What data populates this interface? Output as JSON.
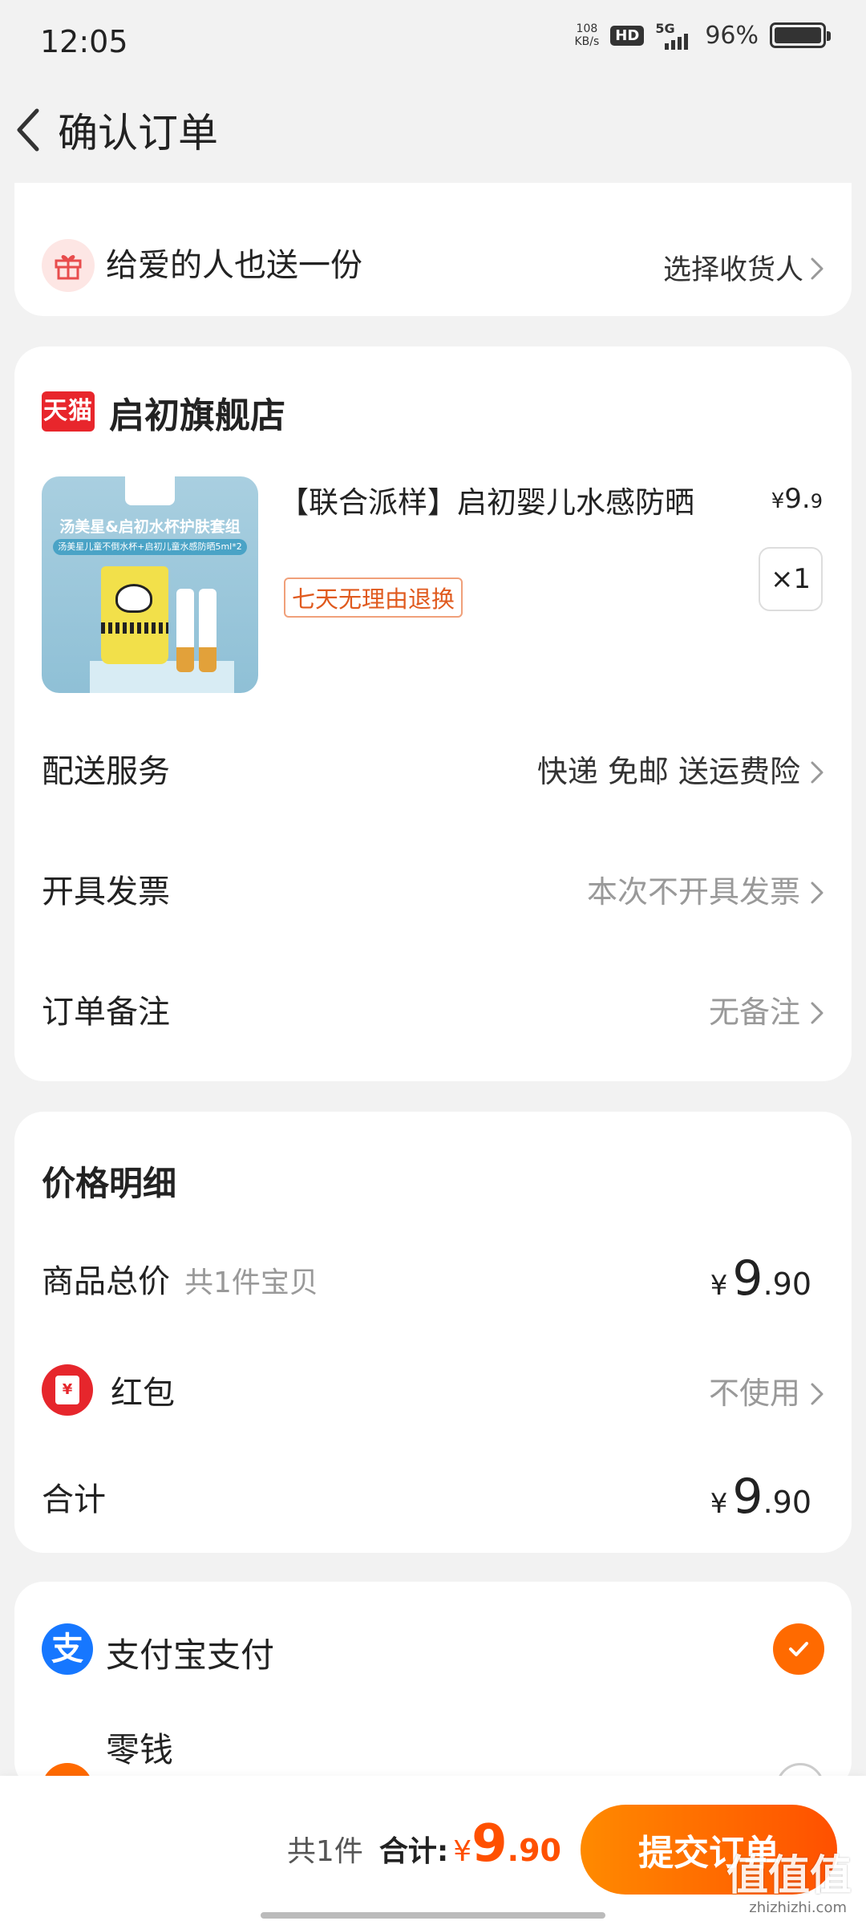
{
  "status_bar": {
    "time": "12:05",
    "net_speed_value": "108",
    "net_speed_unit": "KB/s",
    "hd_badge": "HD",
    "network": "5G",
    "battery_percent": "96%",
    "battery_level": 0.96
  },
  "header": {
    "title": "确认订单",
    "back_icon": "chevron-left-icon"
  },
  "gift": {
    "icon": "gift-icon",
    "text": "给爱的人也送一份",
    "action": "选择收货人"
  },
  "shop": {
    "logo_text": "天猫",
    "name": "启初旗舰店",
    "product": {
      "image_title": "汤美星&启初水杯护肤套组",
      "image_subtitle": "汤美星儿童不倒水杯+启初儿童水感防晒5ml*2",
      "name": "【联合派样】启初婴儿水感防晒",
      "price_currency": "¥",
      "price_int": "9.",
      "price_dec": "9",
      "return_policy": "七天无理由退换",
      "quantity": "×1"
    },
    "rows": [
      {
        "label": "配送服务",
        "value": "快递 免邮 送运费险"
      },
      {
        "label": "开具发票",
        "value": "本次不开具发票"
      },
      {
        "label": "订单备注",
        "value": "无备注"
      }
    ]
  },
  "price_detail": {
    "title": "价格明细",
    "goods_total": {
      "label": "商品总价",
      "sub": "共1件宝贝",
      "currency": "¥",
      "int": "9",
      "dec": ".90"
    },
    "red_packet": {
      "icon_text": "¥",
      "label": "红包",
      "value": "不使用"
    },
    "total": {
      "label": "合计",
      "currency": "¥",
      "int": "9",
      "dec": ".90"
    }
  },
  "payment": {
    "alipay_icon_text": "支",
    "alipay_label": "支付宝支付",
    "alipay_selected": true,
    "change_label": "零钱"
  },
  "bottom": {
    "count": "共1件",
    "total_label": "合计:",
    "currency": "¥",
    "int": "9",
    "dec": ".90",
    "submit": "提交订单"
  },
  "watermark": {
    "text": "值值值",
    "site": "zhizhizhi.com"
  },
  "colors": {
    "accent": "#ff5000",
    "tmall_red": "#e8262c",
    "alipay_blue": "#1677ff"
  }
}
